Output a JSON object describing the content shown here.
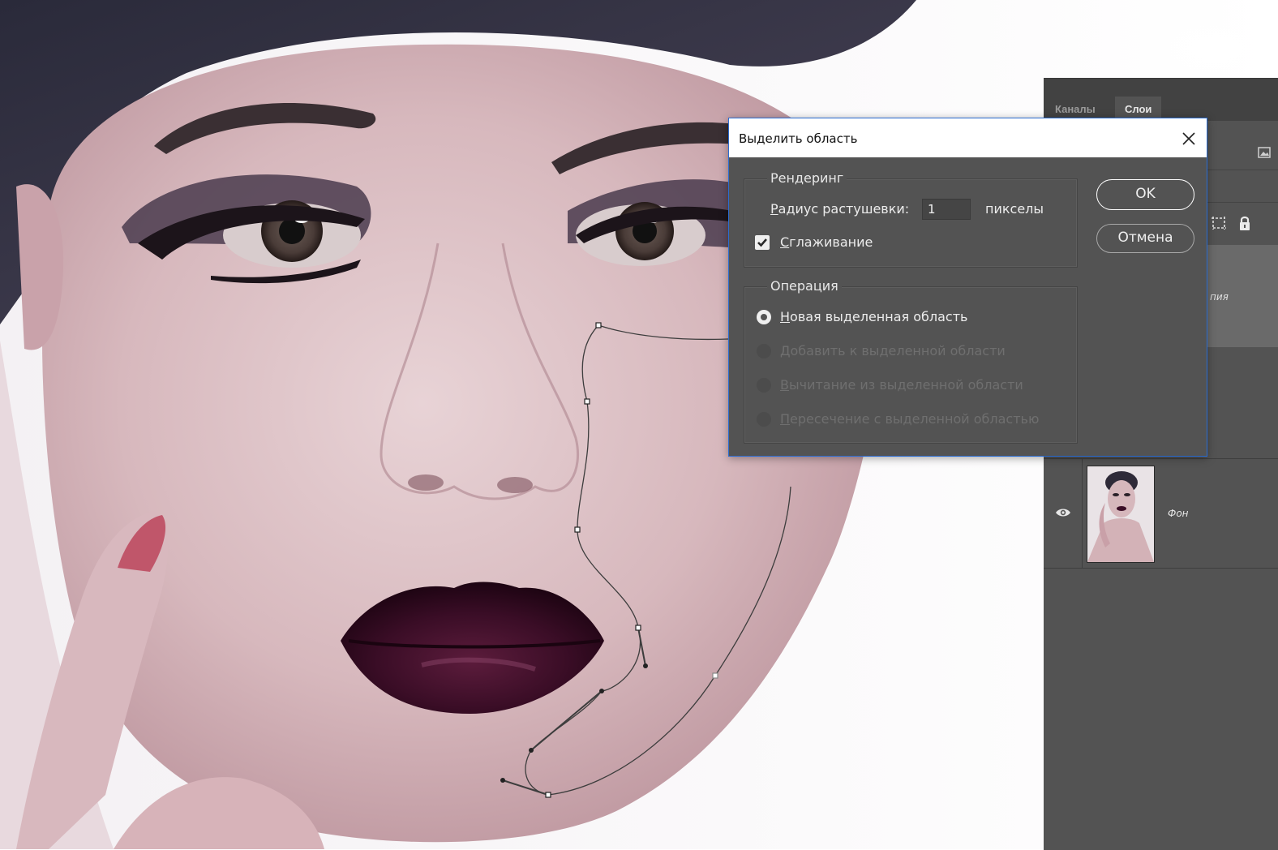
{
  "dialog": {
    "title": "Выделить область",
    "rendering_label": "Рендеринг",
    "radius_prefix_underlined": "Р",
    "radius_label_rest": "адиус растушевки:",
    "radius_value": "1",
    "radius_unit": "пикселы",
    "antialias_underlined": "С",
    "antialias_rest": "глаживание",
    "antialias_checked": true,
    "operation_label": "Операция",
    "operations": [
      {
        "u": "Н",
        "rest": "овая выделенная область",
        "checked": true,
        "enabled": true
      },
      {
        "u": "Д",
        "rest": "обавить к выделенной области",
        "checked": false,
        "enabled": false
      },
      {
        "u": "В",
        "rest": "ычитание из выделенной области",
        "checked": false,
        "enabled": false
      },
      {
        "u": "П",
        "rest": "ересечение с выделенной областью",
        "checked": false,
        "enabled": false
      }
    ],
    "ok_label": "OK",
    "cancel_label": "Отмена"
  },
  "layers_panel": {
    "tabs": [
      "Каналы",
      "Слои"
    ],
    "active_tab": "Слои",
    "copy_layer_partial": "пия",
    "background_layer_name": "Фон"
  },
  "colors": {
    "panel_bg": "#535353",
    "dialog_border": "#2b6cd1",
    "lip": "#3a0d26"
  }
}
